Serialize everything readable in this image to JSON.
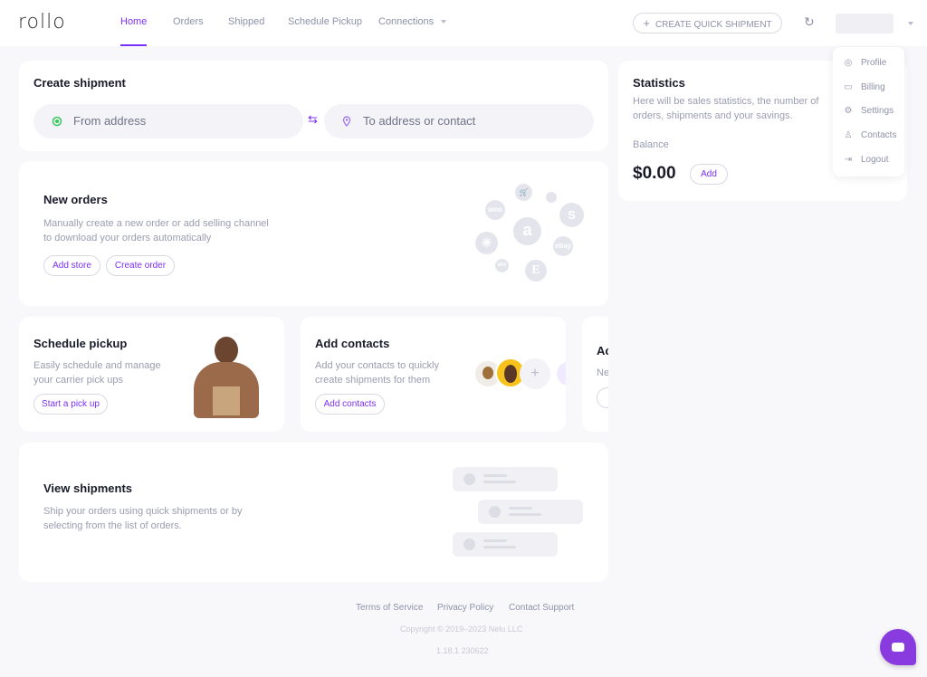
{
  "header": {
    "logo": "rollo",
    "nav": [
      {
        "label": "Home",
        "active": true
      },
      {
        "label": "Orders"
      },
      {
        "label": "Shipped"
      },
      {
        "label": "Schedule Pickup"
      },
      {
        "label": "Connections"
      }
    ],
    "quick_shipment": "CREATE QUICK SHIPMENT"
  },
  "user_menu": {
    "items": [
      {
        "label": "Profile",
        "icon": "user-circle-icon"
      },
      {
        "label": "Billing",
        "icon": "tag-icon"
      },
      {
        "label": "Settings",
        "icon": "gear-icon"
      },
      {
        "label": "Contacts",
        "icon": "person-icon"
      },
      {
        "label": "Logout",
        "icon": "logout-icon"
      }
    ]
  },
  "create_shipment": {
    "title": "Create shipment",
    "from_placeholder": "From address",
    "to_placeholder": "To address or contact"
  },
  "statistics": {
    "title": "Statistics",
    "desc": "Here will be sales statistics, the number of orders, shipments and your savings.",
    "balance_label": "Balance",
    "balance": "$0.00",
    "add": "Add"
  },
  "new_orders": {
    "title": "New orders",
    "desc": "Manually create a new order or add selling channel to download your orders automatically",
    "add_store": "Add store",
    "create_order": "Create order",
    "logos": [
      "woo",
      "wix",
      "ebay",
      "E",
      "a"
    ]
  },
  "schedule_pickup": {
    "title": "Schedule pickup",
    "desc": "Easily schedule and manage your carrier pick ups",
    "button": "Start a pick up"
  },
  "add_contacts": {
    "title": "Add contacts",
    "desc": "Add your contacts to quickly create shipments for them",
    "button": "Add contacts"
  },
  "partial_card": {
    "title": "Ac",
    "desc": "Ne"
  },
  "view_shipments": {
    "title": "View shipments",
    "desc": "Ship your orders using quick shipments or by selecting from the list of orders."
  },
  "footer": {
    "links": [
      "Terms of Service",
      "Privacy Policy",
      "Contact Support"
    ],
    "copyright": "Copyright © 2019–2023 Nelu LLC",
    "version": "1.18.1 230622"
  },
  "colors": {
    "accent": "#7b2ff7",
    "background": "#f8f8fb",
    "chat": "#8a3be0"
  }
}
